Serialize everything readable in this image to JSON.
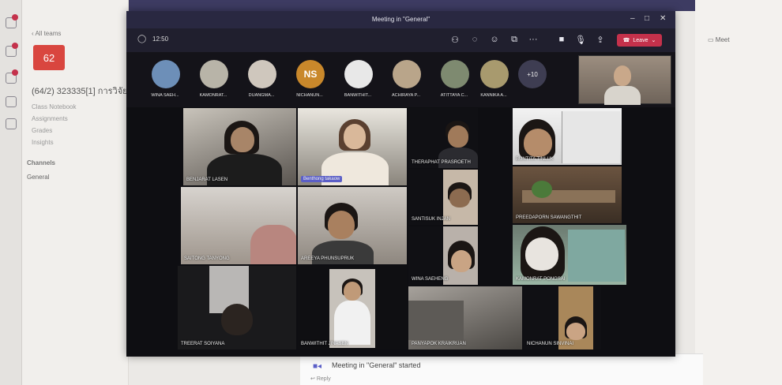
{
  "background_app": {
    "back_link": "All teams",
    "team_tile": "62",
    "team_name": "(64/2) 323335[1] การวิจัย",
    "links": [
      "Class Notebook",
      "Assignments",
      "Grades",
      "Insights"
    ],
    "channels_heading": "Channels",
    "channel": "General",
    "meet_button": "Meet",
    "started_message": "Meeting in \"General\" started",
    "reply_link": "Reply"
  },
  "meeting": {
    "title": "Meeting in \"General\"",
    "timer": "12:50",
    "leave_label": "Leave",
    "more_count": "+10",
    "participants": [
      {
        "name": "WINA SAEH...",
        "initials": "",
        "color": "#6d8fb8"
      },
      {
        "name": "KAMONRAT...",
        "initials": "",
        "color": "#b8b4a8"
      },
      {
        "name": "DUANGMA...",
        "initials": "",
        "color": "#cfc7bd"
      },
      {
        "name": "NICHANUN...",
        "initials": "NS",
        "color": "#c9882b"
      },
      {
        "name": "BANWITHIT...",
        "initials": "",
        "color": "#e8e8e8"
      },
      {
        "name": "ACHIRAYA P...",
        "initials": "",
        "color": "#b9a58a"
      },
      {
        "name": "ATITTAYA C...",
        "initials": "",
        "color": "#7e8a70"
      },
      {
        "name": "KANNIKA A...",
        "initials": "",
        "color": "#a89a6e"
      }
    ],
    "tiles": [
      "BENJARAT LASEN",
      "Benthong takaow",
      "THERAPHAT PRASROETH",
      "BUNTITA TINLUK",
      "SANTISUK INJAN",
      "PREEDAPORN SAWANGTHIT",
      "SAITONG TANYONG",
      "AREEYA PHUNSUPRUK",
      "WINA SAEHENG",
      "KAMONRAT PONGSAI",
      "TREERAT SOIYANA",
      "BANWITHIT JINASEN",
      "PANYAPOK KRAIKRUAN",
      "NICHANUN SINVINAI"
    ]
  },
  "colors": {
    "leave": "#c4314b",
    "titlebar": "#292841",
    "team_tile": "#d9463f",
    "accent": "#5b5fc7"
  }
}
